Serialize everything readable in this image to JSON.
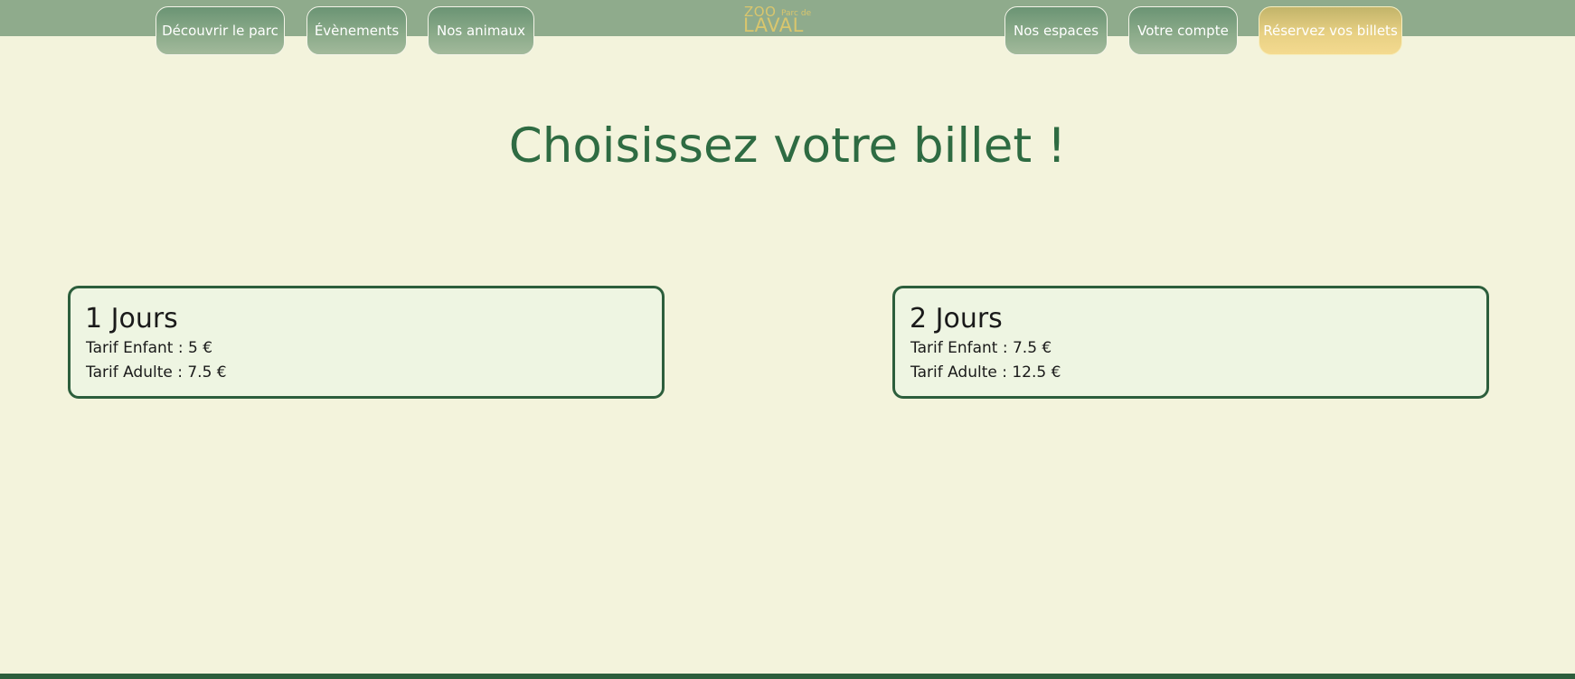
{
  "nav": {
    "left": [
      {
        "label": "Découvrir le parc"
      },
      {
        "label": "Évènements"
      },
      {
        "label": "Nos animaux"
      }
    ],
    "right": [
      {
        "label": "Nos espaces"
      },
      {
        "label": "Votre compte"
      },
      {
        "label": "Réservez vos billets"
      }
    ]
  },
  "logo": {
    "zoo": "ZOO",
    "parc_de": "Parc de",
    "laval": "LAVAL"
  },
  "page": {
    "title": "Choisissez votre billet !"
  },
  "tickets": [
    {
      "title": "1 Jours",
      "child": "Tarif Enfant : 5 €",
      "adult": "Tarif Adulte : 7.5 €"
    },
    {
      "title": "2 Jours",
      "child": "Tarif Enfant : 7.5 €",
      "adult": "Tarif Adulte : 12.5 €"
    }
  ],
  "colors": {
    "background": "#f3f3dc",
    "topbar": "#8fab8c",
    "nav_button": "#8aaa89",
    "cta_button": "#e7d083",
    "title": "#2e6b42",
    "card_border": "#2c5e3c",
    "card_background": "#eef5e2",
    "logo": "#d9c66d",
    "bottom_bar": "#2c5e3c"
  }
}
